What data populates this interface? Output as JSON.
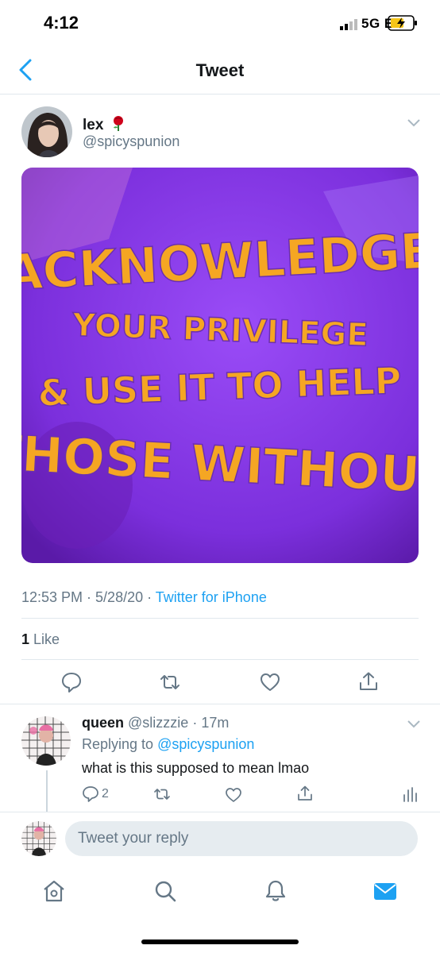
{
  "status_bar": {
    "time": "4:12",
    "network": "5G E"
  },
  "nav": {
    "title": "Tweet"
  },
  "tweet": {
    "author_name": "lex",
    "author_handle": "@spicyspunion",
    "image_text": [
      "ACKNOWLEDGE",
      "YOUR PRIVILEGE",
      "& USE IT TO HELP",
      "THOSE WITHOUT"
    ],
    "time": "12:53 PM",
    "date": "5/28/20",
    "source": "Twitter for iPhone",
    "like_count": "1",
    "like_label": "Like"
  },
  "reply": {
    "name": "queen",
    "handle": "@slizzzie",
    "age": "17m",
    "replying_to_label": "Replying to",
    "replying_to_handle": "@spicyspunion",
    "text": "what is this supposed to mean lmao",
    "reply_count": "2"
  },
  "composer": {
    "placeholder": "Tweet your reply"
  },
  "colors": {
    "accent": "#1da1f2",
    "muted": "#657786",
    "image_purple": "#8e3ff0",
    "image_orange": "#f5a623"
  }
}
